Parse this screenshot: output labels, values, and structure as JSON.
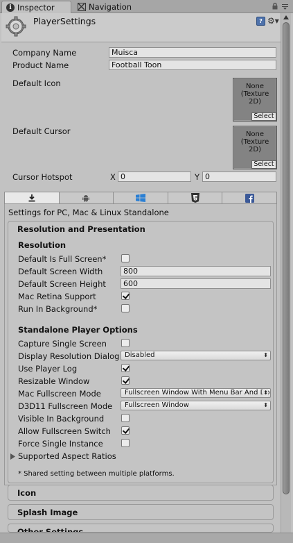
{
  "tabs": {
    "inspector": "Inspector",
    "navigation": "Navigation"
  },
  "header": {
    "title": "PlayerSettings"
  },
  "company": {
    "label": "Company Name",
    "value": "Muisca"
  },
  "product": {
    "label": "Product Name",
    "value": "Football Toon"
  },
  "default_icon": {
    "label": "Default Icon",
    "line1": "None",
    "line2": "(Texture",
    "line3": "2D)",
    "select": "Select"
  },
  "default_cursor": {
    "label": "Default Cursor",
    "line1": "None",
    "line2": "(Texture",
    "line3": "2D)",
    "select": "Select"
  },
  "cursor_hotspot": {
    "label": "Cursor Hotspot",
    "x_label": "X",
    "x_value": "0",
    "y_label": "Y",
    "y_value": "0"
  },
  "platforms": [
    "standalone-icon",
    "android-icon",
    "windows-store-icon",
    "html5-icon",
    "facebook-icon"
  ],
  "settings_for": "Settings for PC, Mac & Linux Standalone",
  "resolution": {
    "section_title": "Resolution and Presentation",
    "sub_title": "Resolution",
    "fullscreen": {
      "label": "Default Is Full Screen*",
      "checked": false
    },
    "width": {
      "label": "Default Screen Width",
      "value": "800"
    },
    "height": {
      "label": "Default Screen Height",
      "value": "600"
    },
    "retina": {
      "label": "Mac Retina Support",
      "checked": true
    },
    "run_bg": {
      "label": "Run In Background*",
      "checked": false
    }
  },
  "standalone": {
    "title": "Standalone Player Options",
    "capture": {
      "label": "Capture Single Screen",
      "checked": false
    },
    "display_dialog": {
      "label": "Display Resolution Dialog",
      "value": "Disabled"
    },
    "player_log": {
      "label": "Use Player Log",
      "checked": true
    },
    "resizable": {
      "label": "Resizable Window",
      "checked": true
    },
    "mac_fullscreen": {
      "label": "Mac Fullscreen Mode",
      "value": "Fullscreen Window With Menu Bar And Dock"
    },
    "d3d11_fullscreen": {
      "label": "D3D11 Fullscreen Mode",
      "value": "Fullscreen Window"
    },
    "visible_bg": {
      "label": "Visible In Background",
      "checked": false
    },
    "allow_switch": {
      "label": "Allow Fullscreen Switch",
      "checked": true
    },
    "single_instance": {
      "label": "Force Single Instance",
      "checked": false
    },
    "aspect": {
      "label": "Supported Aspect Ratios"
    }
  },
  "footnote": "* Shared setting between multiple platforms.",
  "sections": {
    "icon": "Icon",
    "splash": "Splash Image",
    "other": "Other Settings"
  },
  "colors": {
    "accent_blue": "#4e72ab",
    "panel_bg": "#c2c2c2",
    "tab_bg": "#a6a6a6"
  }
}
